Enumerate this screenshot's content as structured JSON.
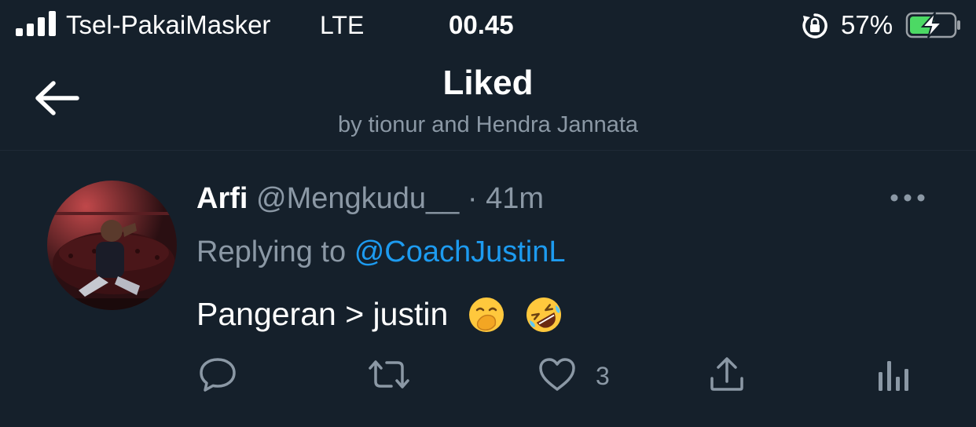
{
  "status_bar": {
    "carrier": "Tsel-PakaiMasker",
    "network": "LTE",
    "time": "00.45",
    "battery_percent": "57%",
    "battery_level": 0.57,
    "icons": [
      "signal-icon",
      "rotation-lock-icon",
      "battery-charging-icon"
    ]
  },
  "header": {
    "title": "Liked",
    "subtitle": "by tionur and Hendra Jannata",
    "back_icon": "back-arrow-icon"
  },
  "tweet": {
    "name": "Arfi",
    "handle": "@Mengkudu__",
    "separator": "·",
    "time": "41m",
    "replying_prefix": "Replying to",
    "replying_to": "@CoachJustinL",
    "text": "Pangeran > justin",
    "emojis": [
      "face-with-hand-over-mouth-emoji",
      "rolling-on-floor-laughing-emoji"
    ],
    "like_count": "3"
  },
  "actions": [
    "reply-icon",
    "retweet-icon",
    "like-icon",
    "share-icon",
    "analytics-icon"
  ],
  "colors": {
    "background": "#15202b",
    "secondary_text": "#8b98a5",
    "accent": "#1d9bf0",
    "battery_fill": "#4cd964"
  }
}
